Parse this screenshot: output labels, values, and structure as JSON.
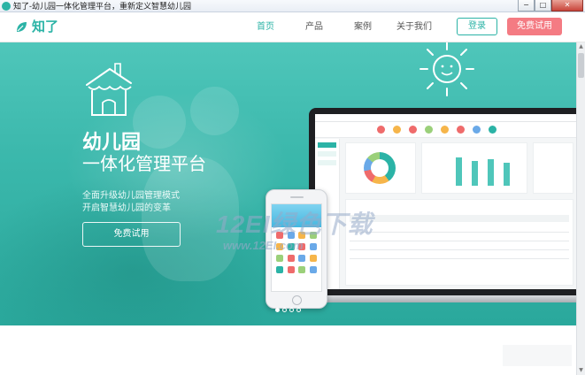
{
  "window": {
    "title": "知了-幼儿园一体化管理平台，重新定义智慧幼儿园",
    "minimize": "−",
    "maximize": "□",
    "close": "✕"
  },
  "nav": {
    "logo_text": "知了",
    "links": [
      "首页",
      "产品",
      "案例",
      "关于我们"
    ],
    "active_index": 0,
    "login": "登录",
    "free_trial": "免费试用"
  },
  "hero": {
    "title": "幼儿园",
    "subtitle": "一体化管理平台",
    "desc_line1": "全面升级幼儿园管理模式",
    "desc_line2": "开启智慧幼儿园的变革",
    "cta": "免费试用",
    "carousel_count": 4,
    "carousel_active": 0
  },
  "watermark": {
    "text": "12EI绿色下载",
    "url": "www.12EI.com"
  },
  "colors": {
    "brand": "#2bb3a6",
    "trial_button": "#f47b83",
    "hero_bg": "#3bb8ac"
  },
  "icons": {
    "logo": "leaf-logo-icon",
    "sun": "sun-doodle-icon",
    "house": "house-doodle-icon"
  }
}
